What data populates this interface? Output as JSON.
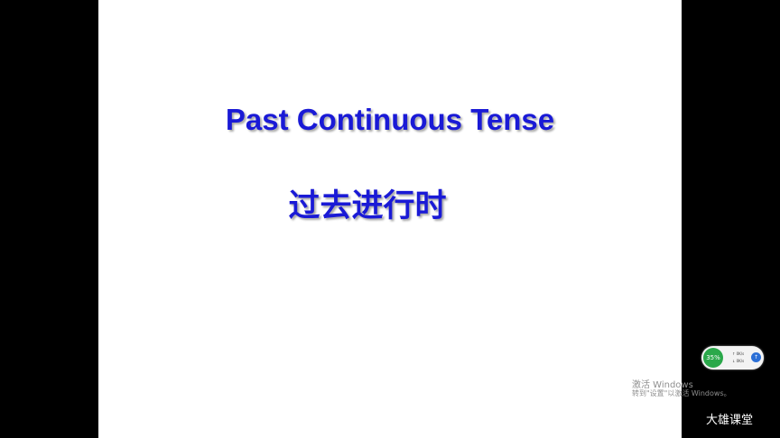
{
  "slide": {
    "title": "Past Continuous Tense",
    "subtitle": "过去进行时",
    "title_color": "#1a1ad6"
  },
  "speed_widget": {
    "percent": "35%",
    "upload": "↑ 0K/s",
    "download": "↓ 0K/s",
    "toggle_icon": "↑",
    "accent": "#2aa84a"
  },
  "windows_activation": {
    "title": "激活 Windows",
    "hint": "转到\"设置\"以激活 Windows。"
  },
  "watermark": "大雄课堂"
}
